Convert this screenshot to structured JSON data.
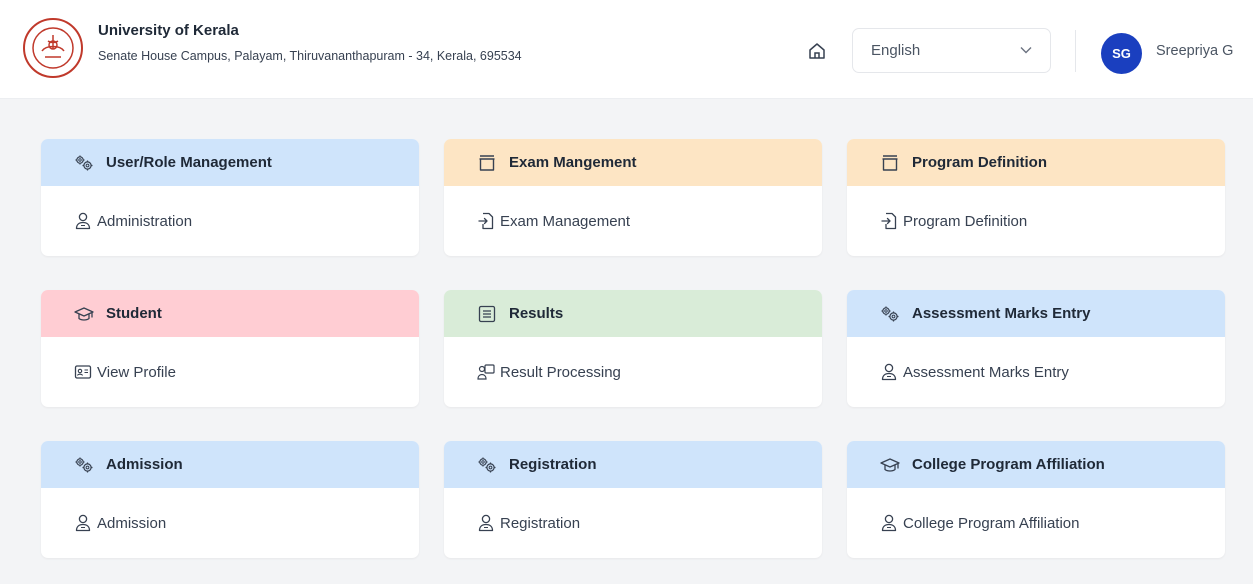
{
  "header": {
    "title": "University of Kerala",
    "address": "Senate House Campus, Palayam, Thiruvananthapuram - 34, Kerala, 695534",
    "language": "English",
    "user_initials": "SG",
    "user_name": "Sreepriya G",
    "avatar_color": "#1a3fbf"
  },
  "cards": [
    {
      "title": "User/Role Management",
      "link": "Administration",
      "header_icon": "gears-icon",
      "link_icon": "user-icon",
      "color": "#cfe4fb"
    },
    {
      "title": "Exam Mangement",
      "link": "Exam Management",
      "header_icon": "archive-box-icon",
      "link_icon": "file-import-icon",
      "color": "#fde5c4"
    },
    {
      "title": "Program Definition",
      "link": "Program Definition",
      "header_icon": "archive-box-icon",
      "link_icon": "file-import-icon",
      "color": "#fde5c4"
    },
    {
      "title": "Student",
      "link": "View Profile",
      "header_icon": "graduation-cap-icon",
      "link_icon": "id-card-icon",
      "color": "#ffcdd3"
    },
    {
      "title": "Results",
      "link": "Result Processing",
      "header_icon": "document-list-icon",
      "link_icon": "user-board-icon",
      "color": "#d9ecd8"
    },
    {
      "title": "Assessment Marks Entry",
      "link": "Assessment Marks Entry",
      "header_icon": "gears-icon",
      "link_icon": "user-icon",
      "color": "#cfe4fb"
    },
    {
      "title": "Admission",
      "link": "Admission",
      "header_icon": "gears-icon",
      "link_icon": "user-icon",
      "color": "#cfe4fb"
    },
    {
      "title": "Registration",
      "link": "Registration",
      "header_icon": "gears-icon",
      "link_icon": "user-icon",
      "color": "#cfe4fb"
    },
    {
      "title": "College Program Affiliation",
      "link": "College Program Affiliation",
      "header_icon": "graduation-cap-icon",
      "link_icon": "user-icon",
      "color": "#cfe4fb"
    }
  ]
}
